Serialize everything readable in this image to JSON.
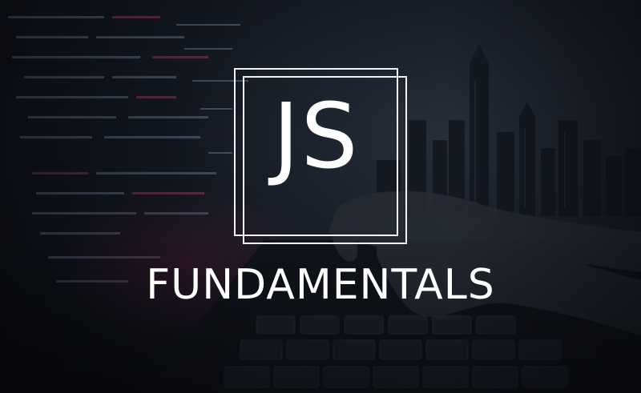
{
  "logo": {
    "label": "JS"
  },
  "heading": {
    "title": "FUNDAMENTALS"
  },
  "colors": {
    "text": "#ffffff",
    "frame": "#f2f2f2",
    "background": "#0b0f16"
  }
}
